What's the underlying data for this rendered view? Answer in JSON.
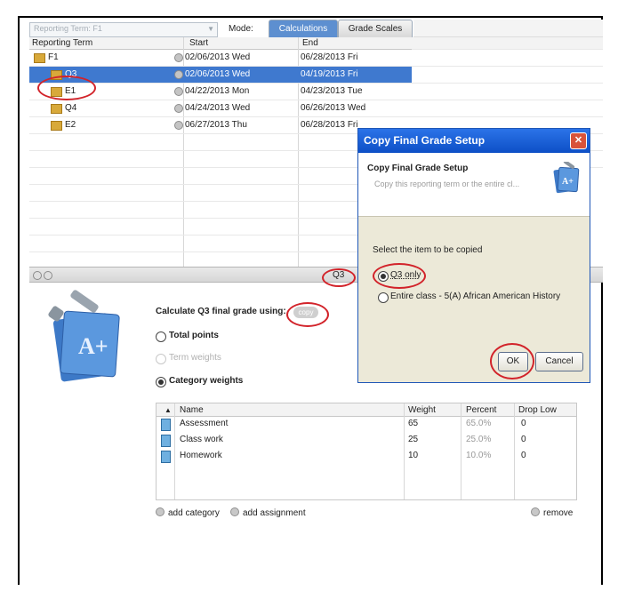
{
  "toolbar": {
    "term_select_value": "Reporting Term: F1",
    "mode_label": "Mode:",
    "tab_calculations": "Calculations",
    "tab_grade_scales": "Grade Scales"
  },
  "terms_table": {
    "headers": [
      "Reporting Term",
      "Start",
      "End"
    ],
    "rows": [
      {
        "name": "F1",
        "start": "02/06/2013 Wed",
        "end": "06/28/2013 Fri"
      },
      {
        "name": "Q3",
        "start": "02/06/2013 Wed",
        "end": "04/19/2013 Fri"
      },
      {
        "name": "E1",
        "start": "04/22/2013 Mon",
        "end": "04/23/2013 Tue"
      },
      {
        "name": "Q4",
        "start": "04/24/2013 Wed",
        "end": "06/26/2013 Wed"
      },
      {
        "name": "E2",
        "start": "06/27/2013 Thu",
        "end": "06/28/2013 Fri"
      }
    ],
    "selected_index": 1
  },
  "splitter": {
    "term_label": "Q3"
  },
  "calc": {
    "label": "Calculate Q3 final grade using:",
    "copy_label": "copy",
    "options": [
      "Total points",
      "Term weights",
      "Category weights"
    ],
    "selected_option": "Category weights"
  },
  "categories": {
    "headers": [
      "Name",
      "Weight",
      "Percent",
      "Drop Low"
    ],
    "rows": [
      {
        "name": "Assessment",
        "weight": "65",
        "percent": "65.0%",
        "drop_low": "0"
      },
      {
        "name": "Class work",
        "weight": "25",
        "percent": "25.0%",
        "drop_low": "0"
      },
      {
        "name": "Homework",
        "weight": "10",
        "percent": "10.0%",
        "drop_low": "0"
      }
    ],
    "sort_indicator": "▲"
  },
  "footer": {
    "add_category": "add category",
    "add_assignment": "add assignment",
    "remove": "remove"
  },
  "dialog": {
    "title": "Copy Final Grade Setup",
    "close": "✕",
    "head_title": "Copy Final Grade Setup",
    "head_subtitle": "Copy this reporting term or the entire cl...",
    "select_label": "Select the item to be copied",
    "option_1": "Q3 only",
    "option_2": "Entire class - 5(A) African American History",
    "ok": "OK",
    "cancel": "Cancel"
  },
  "colors": {
    "selection": "#3f79cf",
    "annotation_red": "#d2232a",
    "dialog_title": "#0d4fc6"
  }
}
